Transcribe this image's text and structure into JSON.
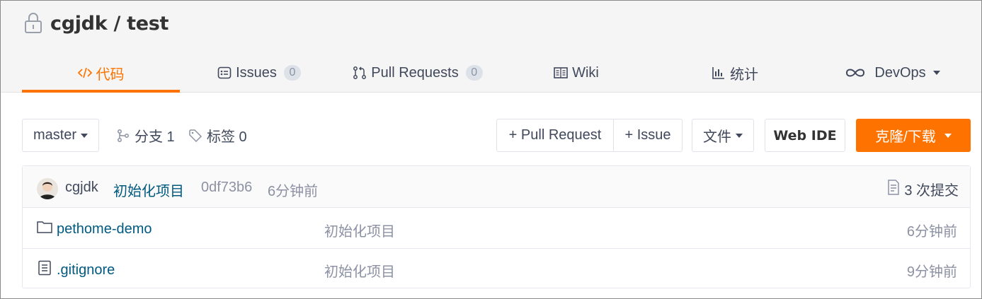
{
  "repo": {
    "owner": "cgjdk",
    "separator": "/",
    "name": "test",
    "title": "cgjdk / test",
    "visibility_icon": "lock-icon"
  },
  "tabs": [
    {
      "label": "代码",
      "icon": "code-icon",
      "active": true
    },
    {
      "label": "Issues",
      "icon": "issues-icon",
      "count": "0"
    },
    {
      "label": "Pull Requests",
      "icon": "pull-request-icon",
      "count": "0"
    },
    {
      "label": "Wiki",
      "icon": "book-icon"
    },
    {
      "label": "统计",
      "icon": "bar-chart-icon"
    },
    {
      "label": "DevOps",
      "icon": "infinity-icon",
      "dropdown": true
    }
  ],
  "toolbar": {
    "branch_select": "master",
    "branches_label": "分支 1",
    "tags_label": "标签 0",
    "new_pr_label": "+ Pull Request",
    "new_issue_label": "+ Issue",
    "file_menu_label": "文件",
    "web_ide_label": "Web IDE",
    "clone_label": "克隆/下载"
  },
  "latest_commit": {
    "author": "cgjdk",
    "message": "初始化项目",
    "hash": "0df73b6",
    "time": "6分钟前",
    "count_label": "3 次提交"
  },
  "files": [
    {
      "name": "pethome-demo",
      "type": "folder",
      "icon": "folder-icon",
      "message": "初始化项目",
      "time": "6分钟前"
    },
    {
      "name": ".gitignore",
      "type": "file",
      "icon": "file-icon",
      "message": "初始化项目",
      "time": "9分钟前"
    }
  ],
  "colors": {
    "accent": "#fe7300",
    "link": "#005980",
    "muted": "#8c92a4",
    "text": "#40485b"
  }
}
